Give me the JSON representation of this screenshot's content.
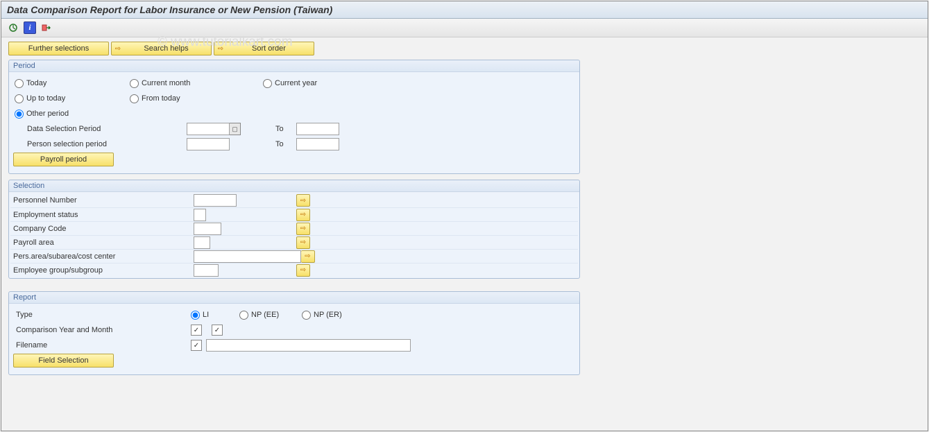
{
  "title": "Data Comparison Report for Labor Insurance or New Pension (Taiwan)",
  "watermark": "© www.tutorialkart.com",
  "toolbar": {
    "execute_icon": "⊕",
    "info_icon": "ℹ",
    "variants_icon": "⇢"
  },
  "selectionButtons": {
    "further": "Further selections",
    "searchHelps": "Search helps",
    "sortOrder": "Sort order"
  },
  "period": {
    "group": "Period",
    "today": "Today",
    "currentMonth": "Current month",
    "currentYear": "Current year",
    "upToToday": "Up to today",
    "fromToday": "From today",
    "otherPeriod": "Other period",
    "dataSelPeriod": "Data Selection Period",
    "personSelPeriod": "Person selection period",
    "to": "To",
    "payrollPeriod": "Payroll period"
  },
  "selection": {
    "group": "Selection",
    "personnelNumber": "Personnel Number",
    "employmentStatus": "Employment status",
    "companyCode": "Company Code",
    "payrollArea": "Payroll area",
    "persArea": "Pers.area/subarea/cost center",
    "empGroup": "Employee group/subgroup"
  },
  "report": {
    "group": "Report",
    "type": "Type",
    "li": "LI",
    "npee": "NP (EE)",
    "nper": "NP (ER)",
    "compYM": "Comparison Year and Month",
    "filename": "Filename",
    "fieldSelection": "Field Selection"
  }
}
